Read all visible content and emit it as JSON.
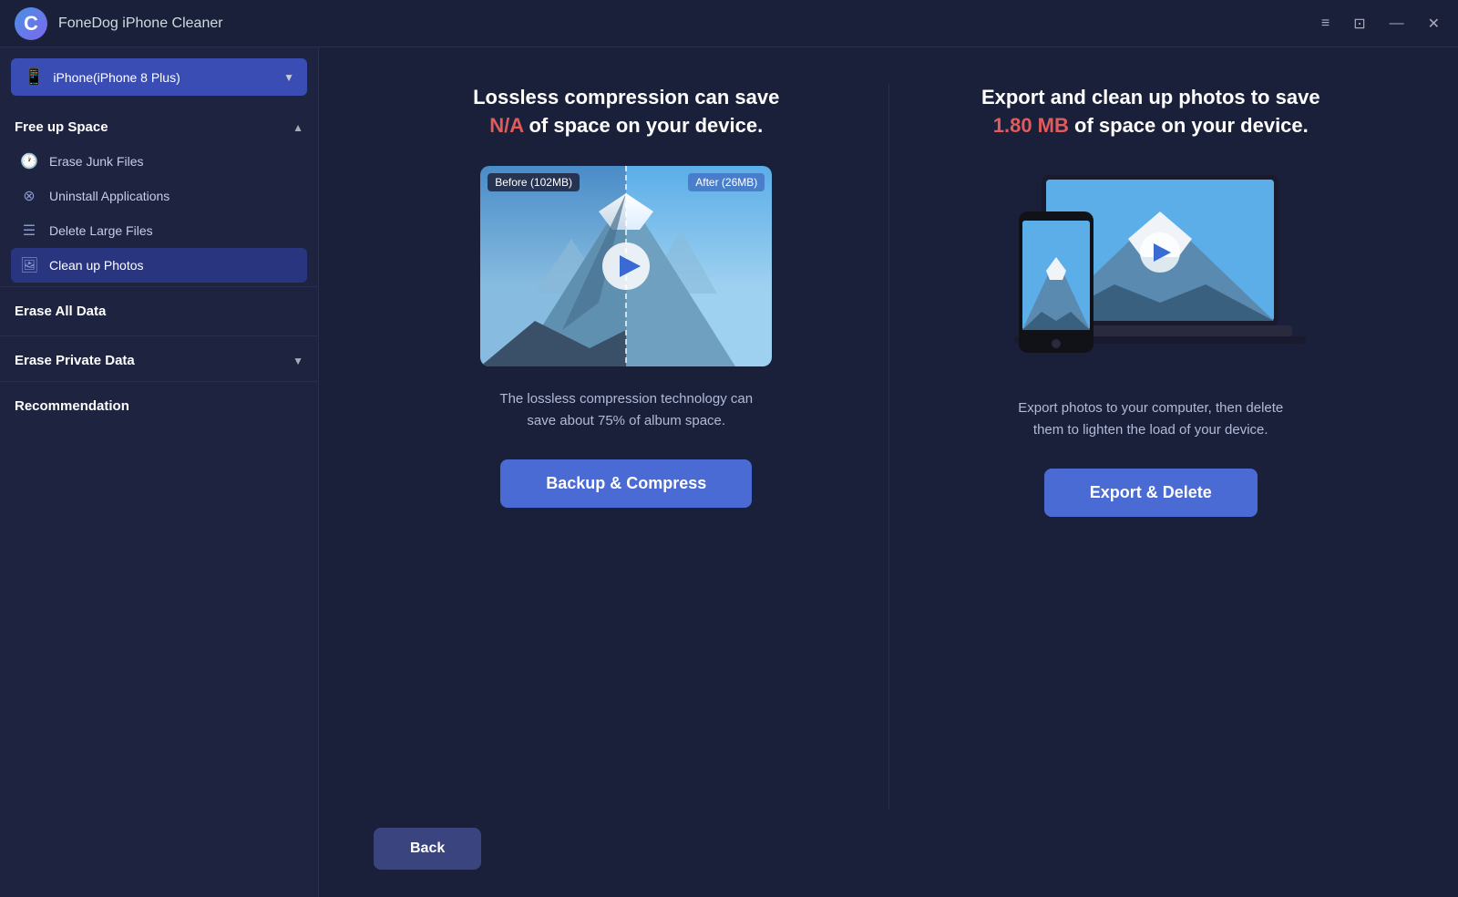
{
  "app": {
    "logo_letter": "C",
    "title": "FoneDog iPhone Cleaner"
  },
  "titlebar_controls": {
    "menu_label": "≡",
    "chat_label": "⊡",
    "minimize_label": "—",
    "close_label": "✕"
  },
  "device_selector": {
    "label": "iPhone(iPhone 8 Plus)",
    "icon": "📱"
  },
  "sidebar": {
    "free_up_space": {
      "title": "Free up Space",
      "items": [
        {
          "label": "Erase Junk Files",
          "icon": "🕐"
        },
        {
          "label": "Uninstall Applications",
          "icon": "⊗"
        },
        {
          "label": "Delete Large Files",
          "icon": "☰"
        },
        {
          "label": "Clean up Photos",
          "icon": "🖼"
        }
      ]
    },
    "erase_all_data": "Erase All Data",
    "erase_private_data": "Erase Private Data",
    "recommendation": "Recommendation"
  },
  "left_panel": {
    "heading_part1": "Lossless compression can save",
    "heading_highlight": "N/A",
    "heading_part2": "of space on your device.",
    "badge_left": "Before (102MB)",
    "badge_right": "After (26MB)",
    "description": "The lossless compression technology can save about 75% of album space.",
    "button_label": "Backup & Compress"
  },
  "right_panel": {
    "heading_part1": "Export and clean up photos to save",
    "heading_highlight": "1.80 MB",
    "heading_part2": "of space on your device.",
    "description": "Export photos to your computer, then delete them to lighten the load of your device.",
    "button_label": "Export & Delete"
  },
  "footer": {
    "back_label": "Back"
  }
}
